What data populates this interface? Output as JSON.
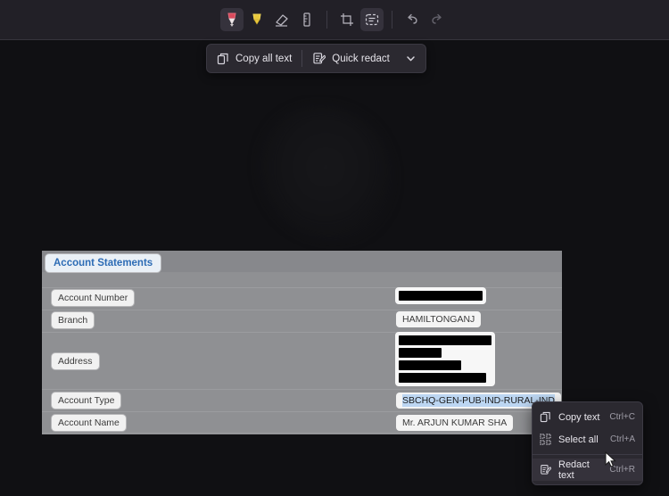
{
  "toolbar": {
    "tools": [
      {
        "name": "red-highlighter-icon",
        "label": "Red highlighter",
        "active": true
      },
      {
        "name": "yellow-highlighter-icon",
        "label": "Yellow highlighter",
        "active": false
      },
      {
        "name": "eraser-icon",
        "label": "Eraser",
        "active": false
      },
      {
        "name": "ruler-icon",
        "label": "Ruler",
        "active": false
      },
      {
        "name": "crop-icon",
        "label": "Crop",
        "active": false
      },
      {
        "name": "text-select-icon",
        "label": "Text select",
        "active": true
      },
      {
        "name": "undo-icon",
        "label": "Undo",
        "active": false
      },
      {
        "name": "redo-icon",
        "label": "Redo",
        "active": false
      }
    ]
  },
  "action_bar": {
    "copy_all_text": "Copy all text",
    "quick_redact": "Quick redact",
    "chevron": "chevron-down-icon"
  },
  "document": {
    "title": "Account Statements",
    "fields": [
      {
        "label": "Account Number",
        "value": "",
        "redacted": true,
        "bars": [
          150
        ]
      },
      {
        "label": "Branch",
        "value": "HAMILTONGANJ",
        "redacted": false
      },
      {
        "label": "Address",
        "value": "",
        "redacted": true,
        "bars": [
          100,
          45,
          65,
          95
        ]
      },
      {
        "label": "Account Type",
        "value": "SBCHQ-GEN-PUB-IND-RURAL-IND",
        "redacted": false,
        "selected": true
      },
      {
        "label": "Account Name",
        "value": "Mr. ARJUN KUMAR SHA",
        "redacted": false
      }
    ]
  },
  "context_menu": {
    "items": [
      {
        "icon": "copy-icon",
        "label": "Copy text",
        "accel": "Ctrl+C",
        "hovered": false
      },
      {
        "icon": "select-all-icon",
        "label": "Select all",
        "accel": "Ctrl+A",
        "hovered": false
      },
      {
        "icon": "redact-icon",
        "label": "Redact text",
        "accel": "Ctrl+R",
        "hovered": true
      }
    ]
  },
  "colors": {
    "app_background": "#101013",
    "toolbar_background": "#222027",
    "menu_background": "#2b2930",
    "document_background": "#8f9093",
    "title_accent": "#2d6cb5",
    "selection_highlight": "#bcd6f2",
    "redaction": "#000000"
  }
}
